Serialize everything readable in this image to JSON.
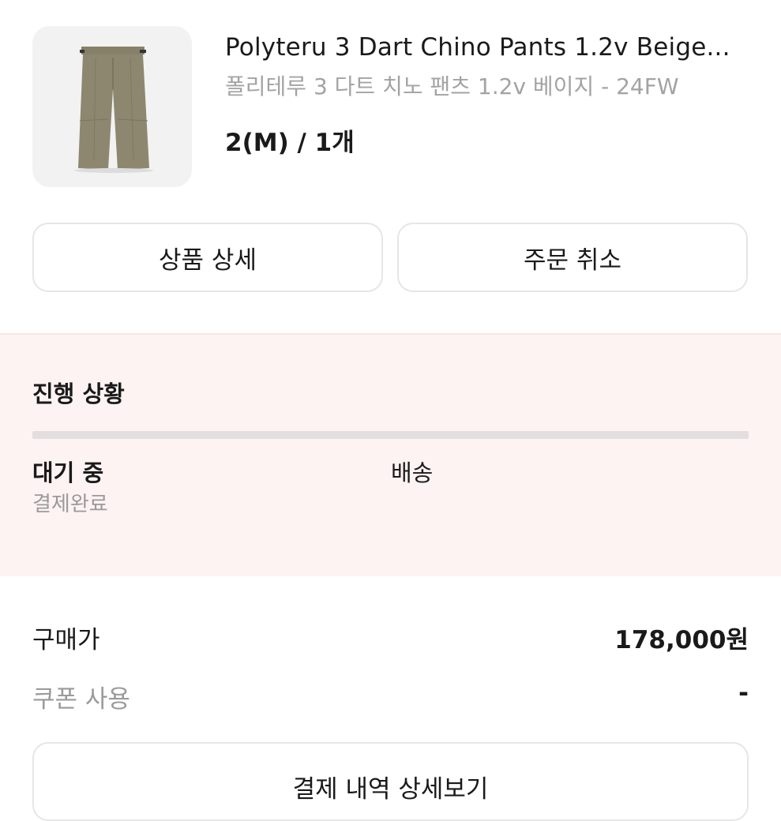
{
  "product": {
    "title": "Polyteru 3 Dart Chino Pants 1.2v Beige...",
    "subtitle": "폴리테루 3 다트 치노 팬츠 1.2v 베이지 - 24FW",
    "option": "2(M) / 1개",
    "image_icon": "pants-image"
  },
  "actions": {
    "detail_label": "상품 상세",
    "cancel_label": "주문 취소"
  },
  "progress": {
    "title": "진행 상황",
    "current_step": "대기 중",
    "current_step_sub": "결제완료",
    "next_step": "배송",
    "bar_color": "#e3dfde",
    "background": "#fdf3f2"
  },
  "payment": {
    "price_label": "구매가",
    "price_value": "178,000원",
    "coupon_label": "쿠폰 사용",
    "coupon_value": "-",
    "details_button": "결제 내역 상세보기"
  }
}
